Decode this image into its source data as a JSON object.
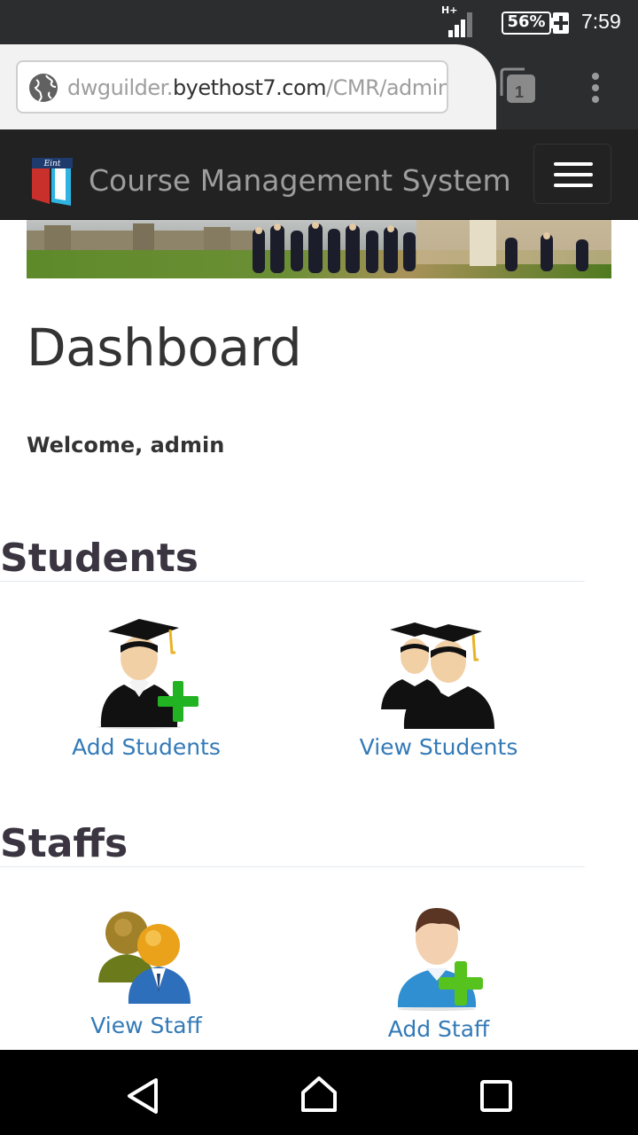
{
  "status_bar": {
    "network_type": "H+",
    "battery_percent": "56%",
    "time": "7:59"
  },
  "browser": {
    "url_prefix": "dwguilder.",
    "url_host": "byethost7.com",
    "url_path": "/CMR/admin",
    "tab_count": "1"
  },
  "navbar": {
    "brand_title": "Course Management System",
    "logo_text": "Eint"
  },
  "page": {
    "title": "Dashboard",
    "welcome": "Welcome, admin"
  },
  "sections": {
    "students": {
      "heading": "Students",
      "add_label": "Add Students",
      "view_label": "View Students"
    },
    "staffs": {
      "heading": "Staffs",
      "view_label": "View Staff",
      "add_label": "Add Staff"
    }
  },
  "colors": {
    "navbar_bg": "#222222",
    "link": "#337ab7",
    "plus_green": "#22b322"
  }
}
